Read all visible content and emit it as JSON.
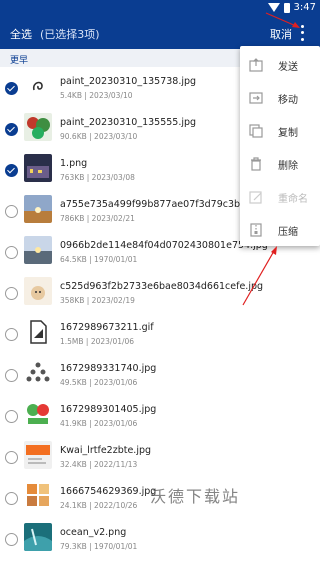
{
  "status_bar": {
    "time": "3:47"
  },
  "top_bar": {
    "select_all": "全选",
    "selected_count": "(已选择3项)",
    "cancel": "取消"
  },
  "section": {
    "label": "更早"
  },
  "files": [
    {
      "name": "paint_20230310_135738.jpg",
      "meta": "5.4KB | 2023/03/10",
      "checked": true
    },
    {
      "name": "paint_20230310_135555.jpg",
      "meta": "90.6KB | 2023/03/10",
      "checked": true
    },
    {
      "name": "1.png",
      "meta": "763KB | 2023/03/08",
      "checked": true
    },
    {
      "name": "a755e735a499f99b877ae07f3d79c3bc.jpg",
      "meta": "786KB | 2023/02/21",
      "checked": false
    },
    {
      "name": "0966b2de114e84f04d0702430801e754.jpg",
      "meta": "64.5KB | 1970/01/01",
      "checked": false
    },
    {
      "name": "c525d963f2b2733e6bae8034d661cefe.jpg",
      "meta": "358KB | 2023/02/19",
      "checked": false
    },
    {
      "name": "1672989673211.gif",
      "meta": "1.5MB | 2023/01/06",
      "checked": false
    },
    {
      "name": "1672989331740.jpg",
      "meta": "49.5KB | 2023/01/06",
      "checked": false
    },
    {
      "name": "1672989301405.jpg",
      "meta": "41.9KB | 2023/01/06",
      "checked": false
    },
    {
      "name": "Kwai_lrtfe2zbte.jpg",
      "meta": "32.4KB | 2022/11/13",
      "checked": false
    },
    {
      "name": "1666754629369.jpg",
      "meta": "24.1KB | 2022/10/26",
      "checked": false
    },
    {
      "name": "ocean_v2.png",
      "meta": "79.3KB | 1970/01/01",
      "checked": false
    }
  ],
  "menu": [
    {
      "label": "发送",
      "icon": "send-icon",
      "disabled": false
    },
    {
      "label": "移动",
      "icon": "move-icon",
      "disabled": false
    },
    {
      "label": "复制",
      "icon": "copy-icon",
      "disabled": false
    },
    {
      "label": "删除",
      "icon": "delete-icon",
      "disabled": false
    },
    {
      "label": "重命名",
      "icon": "rename-icon",
      "disabled": true
    },
    {
      "label": "压缩",
      "icon": "compress-icon",
      "disabled": false
    }
  ],
  "watermark": "沃德下载站",
  "colors": {
    "primary": "#0a3d91",
    "annotation": "#e02020"
  }
}
